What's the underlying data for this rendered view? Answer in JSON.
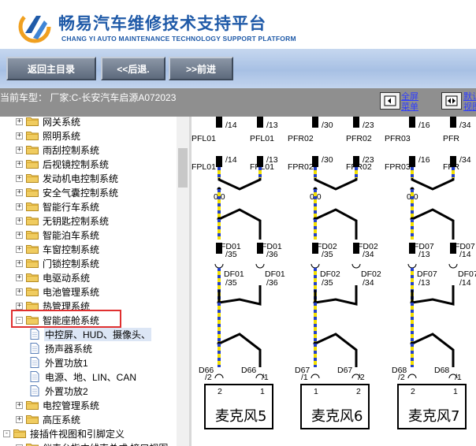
{
  "header": {
    "title": "畅易汽车维修技术支持平台",
    "subtitle": "CHANG YI AUTO MAINTENANCE TECHNOLOGY SUPPORT PLATFORM"
  },
  "toolbar": {
    "home_label": "返回主目录",
    "back_label": "<<后退.",
    "forward_label": ">>前进"
  },
  "infobar": {
    "vehicle_text": "当前车型： 厂家:C-长安汽车启源A072023",
    "fullscreen_line1": "全屏",
    "fullscreen_line2": "菜单",
    "default_line1": "默认",
    "default_line2": "视图"
  },
  "tree": {
    "items": [
      {
        "label": "网关系统",
        "level": 1,
        "expander": "+"
      },
      {
        "label": "照明系统",
        "level": 1,
        "expander": "+"
      },
      {
        "label": "雨刮控制系统",
        "level": 1,
        "expander": "+"
      },
      {
        "label": "后视镜控制系统",
        "level": 1,
        "expander": "+"
      },
      {
        "label": "发动机电控制系统",
        "level": 1,
        "expander": "+"
      },
      {
        "label": "安全气囊控制系统",
        "level": 1,
        "expander": "+"
      },
      {
        "label": "智能行车系统",
        "level": 1,
        "expander": "+"
      },
      {
        "label": "无钥匙控制系统",
        "level": 1,
        "expander": "+"
      },
      {
        "label": "智能泊车系统",
        "level": 1,
        "expander": "+"
      },
      {
        "label": "车窗控制系统",
        "level": 1,
        "expander": "+"
      },
      {
        "label": "门锁控制系统",
        "level": 1,
        "expander": "+"
      },
      {
        "label": "电驱动系统",
        "level": 1,
        "expander": "+"
      },
      {
        "label": "电池管理系统",
        "level": 1,
        "expander": "+"
      },
      {
        "label": "热管理系统",
        "level": 1,
        "expander": "+"
      },
      {
        "label": "智能座舱系统",
        "level": 1,
        "expander": "-"
      },
      {
        "label": "中控屏、HUD、摄像头、",
        "level": 2,
        "expander": ""
      },
      {
        "label": "扬声器系统",
        "level": 2,
        "expander": ""
      },
      {
        "label": "外置功放1",
        "level": 2,
        "expander": ""
      },
      {
        "label": "电源、地、LIN、CAN",
        "level": 2,
        "expander": ""
      },
      {
        "label": "外置功放2",
        "level": 2,
        "expander": ""
      },
      {
        "label": "电控管理系统",
        "level": 1,
        "expander": "+"
      },
      {
        "label": "高压系统",
        "level": 1,
        "expander": "+"
      },
      {
        "label": "接插件视图和引脚定义",
        "level": 0,
        "expander": "-"
      },
      {
        "label": "仪表台指中线束总成 接口视图",
        "level": 1,
        "expander": ""
      }
    ]
  },
  "diagram": {
    "columns": [
      {
        "top_pins": [
          "/14",
          "/13"
        ],
        "row1": [
          "PFL01",
          "PFL01"
        ],
        "row2_pins": [
          "/14",
          "/13"
        ],
        "row2": [
          "FPL01",
          "FPL01"
        ],
        "value": "0.0",
        "fd": [
          "FD01",
          "FD01"
        ],
        "fd_pins": [
          "/35",
          "/36"
        ],
        "df": [
          "DF01",
          "DF01"
        ],
        "df_pins": [
          "/35",
          "/36"
        ],
        "d": [
          "D66",
          "D66"
        ],
        "d_pins": [
          "/2",
          "/1"
        ],
        "mic_pins": [
          "2",
          "1"
        ],
        "mic": "麦克风5"
      },
      {
        "top_pins": [
          "/30",
          "/23"
        ],
        "row1": [
          "PFR02",
          "PFR02"
        ],
        "row2_pins": [
          "/30",
          "/23"
        ],
        "row2": [
          "FPR02",
          "FPR02"
        ],
        "value": "0.0",
        "fd": [
          "FD02",
          "FD02"
        ],
        "fd_pins": [
          "/35",
          "/34"
        ],
        "df": [
          "DF02",
          "DF02"
        ],
        "df_pins": [
          "/35",
          "/34"
        ],
        "d": [
          "D67",
          "D67"
        ],
        "d_pins": [
          "/1",
          "/2"
        ],
        "mic_pins": [
          "1",
          "2"
        ],
        "mic": "麦克风6"
      },
      {
        "top_pins": [
          "/16",
          "/34"
        ],
        "row1": [
          "PFR03",
          "PFR"
        ],
        "row2_pins": [
          "/16",
          "/34"
        ],
        "row2": [
          "FPR03",
          "FPR"
        ],
        "value": "0.0",
        "fd": [
          "FD07",
          "FD07"
        ],
        "fd_pins": [
          "/13",
          "/14"
        ],
        "df": [
          "DF07",
          "DF07"
        ],
        "df_pins": [
          "/13",
          "/14"
        ],
        "d": [
          "D68",
          "D68"
        ],
        "d_pins": [
          "/2",
          "/1"
        ],
        "mic_pins": [
          "2",
          "1"
        ],
        "mic": "麦克风7"
      }
    ]
  },
  "colors": {
    "brand_blue": "#1f5aa8",
    "toolbar_bg": "#b4c9e9",
    "infobar_bg": "#8f8f8f",
    "wire_yellow": "#f2df00",
    "wire_blue": "#2440c8",
    "highlight_red": "#e03030",
    "folder_yellow": "#f0cc60"
  }
}
